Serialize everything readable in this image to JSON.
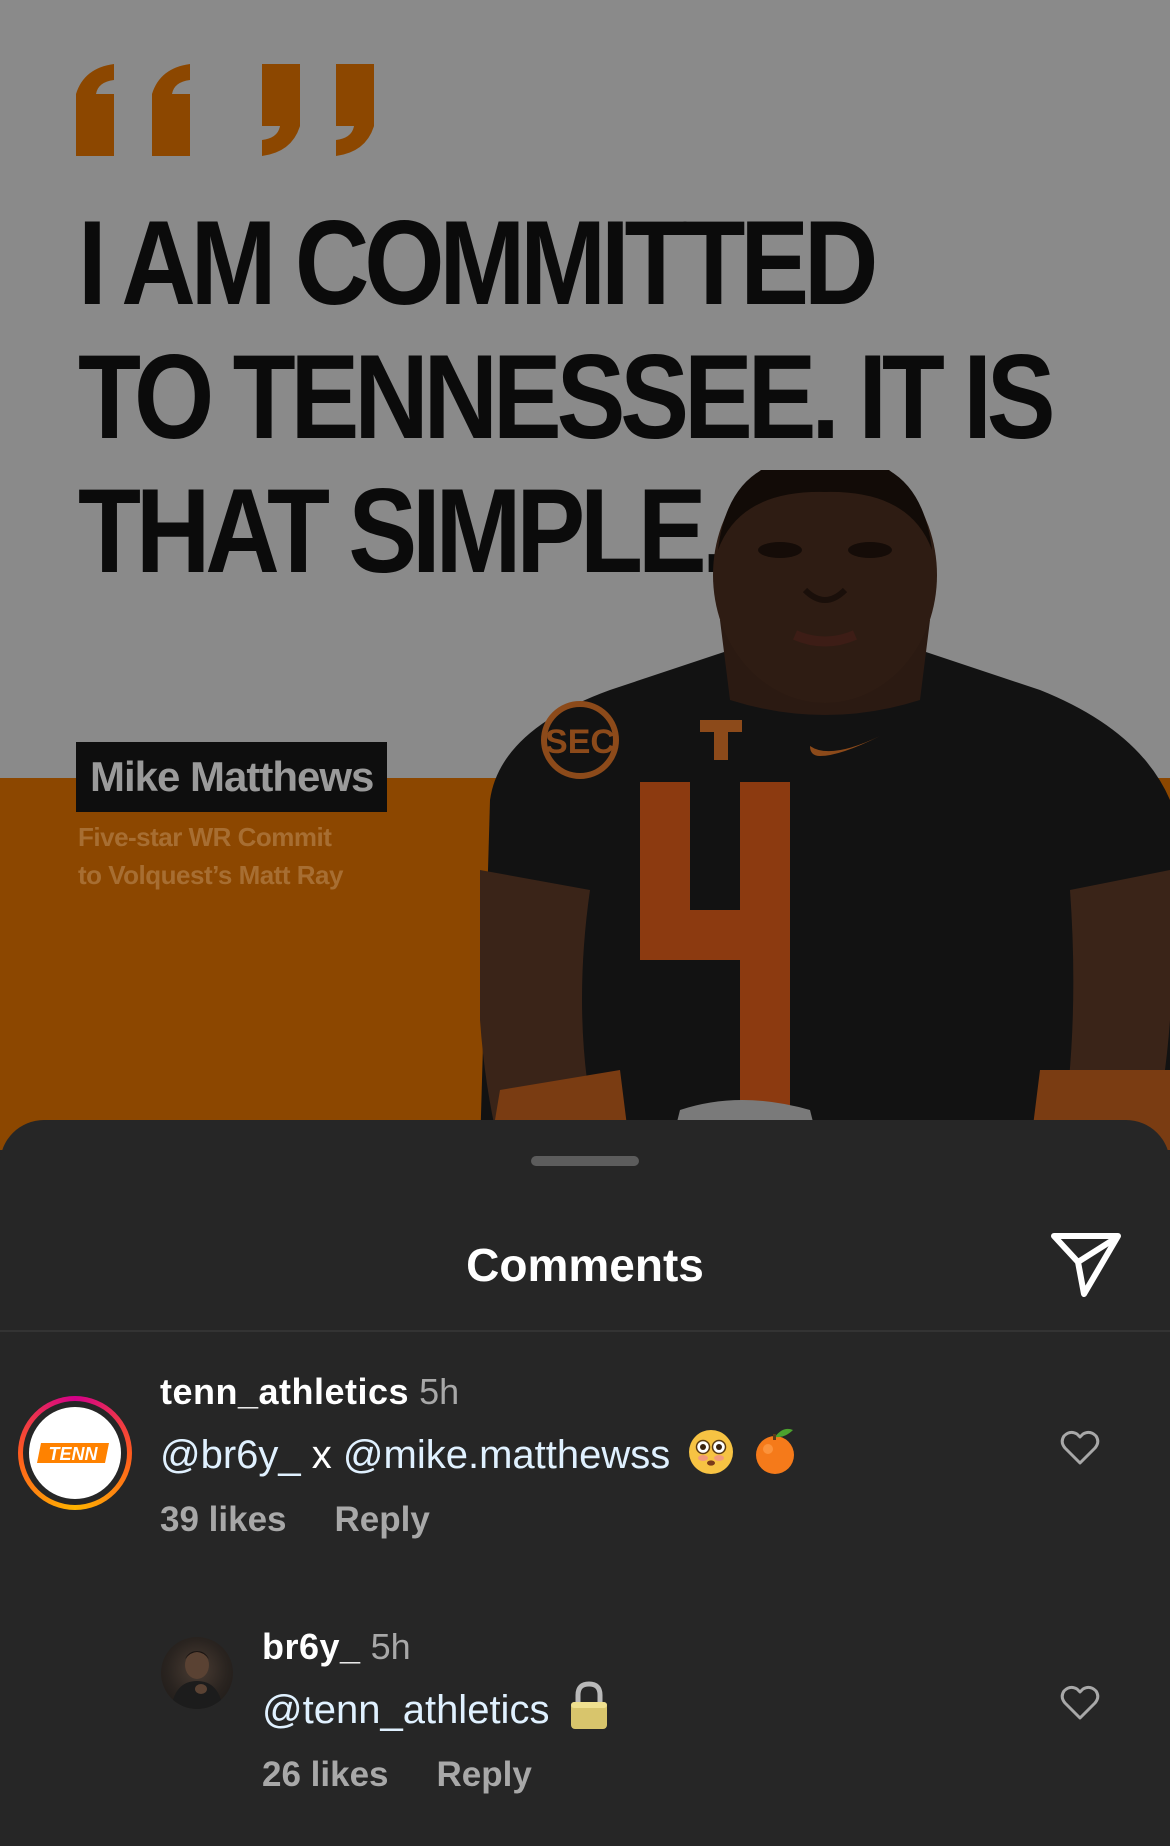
{
  "post": {
    "headline_lines": [
      "I AM COMMITTED",
      "TO TENNESSEE. IT IS",
      "THAT SIMPLE."
    ],
    "name_tag": "Mike Matthews",
    "subline_lines": [
      "Five-star WR Commit",
      "to Volquest’s Matt Ray"
    ],
    "jersey_number": "4",
    "colors": {
      "orange": "#ff8200",
      "dim_overlay": "rgba(0,0,0,0.45)"
    }
  },
  "sheet": {
    "title": "Comments",
    "share_icon": "send-icon"
  },
  "comments": [
    {
      "username": "tenn_athletics",
      "time": "5h",
      "mentions": [
        "@br6y_",
        "@mike.matthewss"
      ],
      "joiner": "x",
      "emojis": [
        "flushed-face-emoji",
        "tangerine-emoji"
      ],
      "likes": "39 likes",
      "reply": "Reply",
      "avatar_text": "TENN"
    },
    {
      "username": "br6y_",
      "time": "5h",
      "mentions": [
        "@tenn_athletics"
      ],
      "emojis": [
        "lock-emoji"
      ],
      "likes": "26 likes",
      "reply": "Reply"
    }
  ]
}
